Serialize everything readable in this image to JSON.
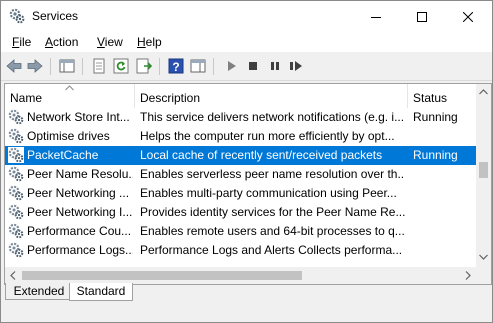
{
  "window": {
    "title": "Services"
  },
  "menu": [
    {
      "accel": "F",
      "rest": "ile"
    },
    {
      "accel": "A",
      "rest": "ction"
    },
    {
      "accel": "V",
      "rest": "iew"
    },
    {
      "accel": "H",
      "rest": "elp"
    }
  ],
  "toolbar": {
    "icons": [
      "back-icon",
      "forward-icon",
      "console-tree-icon",
      "properties-icon",
      "refresh-icon",
      "export-list-icon",
      "help-icon",
      "show-hide-icon",
      "start-icon",
      "stop-icon",
      "pause-icon",
      "restart-icon"
    ]
  },
  "table": {
    "columns": {
      "name": "Name",
      "description": "Description",
      "status": "Status"
    },
    "rows": [
      {
        "name": "Network Store Int...",
        "description": "This service delivers network notifications (e.g. i...",
        "status": "Running",
        "selected": false
      },
      {
        "name": "Optimise drives",
        "description": "Helps the computer run more efficiently by opt...",
        "status": "",
        "selected": false
      },
      {
        "name": "PacketCache",
        "description": "Local cache of recently sent/received packets",
        "status": "Running",
        "selected": true
      },
      {
        "name": "Peer Name Resolu...",
        "description": "Enables serverless peer name resolution over th...",
        "status": "",
        "selected": false
      },
      {
        "name": "Peer Networking ...",
        "description": "Enables multi-party communication using Peer...",
        "status": "",
        "selected": false
      },
      {
        "name": "Peer Networking I...",
        "description": "Provides identity services for the Peer Name Re...",
        "status": "",
        "selected": false
      },
      {
        "name": "Performance Cou...",
        "description": "Enables remote users and 64-bit processes to q...",
        "status": "",
        "selected": false
      },
      {
        "name": "Performance Logs...",
        "description": "Performance Logs and Alerts Collects performa...",
        "status": "",
        "selected": false
      }
    ]
  },
  "tabs": {
    "extended": "Extended",
    "standard": "Standard",
    "active": "Standard"
  },
  "colors": {
    "selection": "#0078d7",
    "accent": "#0078d7"
  }
}
